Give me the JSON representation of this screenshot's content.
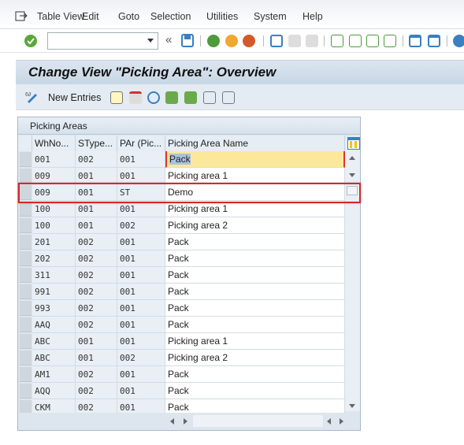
{
  "menu": {
    "items": [
      "Table View",
      "Edit",
      "Goto",
      "Selection",
      "Utilities",
      "System",
      "Help"
    ]
  },
  "toolbar": {
    "command_field_value": "",
    "icons": [
      "enter-icon",
      "back-double-icon",
      "save-icon",
      "back-icon",
      "exit-icon",
      "cancel-icon",
      "print-icon",
      "find-icon",
      "find-next-icon",
      "first-page-icon",
      "previous-page-icon",
      "next-page-icon",
      "last-page-icon",
      "new-session-icon",
      "shortcut-icon",
      "help-icon"
    ]
  },
  "title": "Change View \"Picking Area\": Overview",
  "app_toolbar": {
    "new_entries_label": "New Entries"
  },
  "table": {
    "group_title": "Picking Areas",
    "columns": [
      "WhNo...",
      "SType...",
      "PAr (Pic...",
      "Picking Area Name"
    ],
    "rows": [
      [
        "001",
        "002",
        "001",
        "Pack"
      ],
      [
        "009",
        "001",
        "001",
        "Picking area 1"
      ],
      [
        "009",
        "001",
        "ST",
        "Demo"
      ],
      [
        "100",
        "001",
        "001",
        "Picking area 1"
      ],
      [
        "100",
        "001",
        "002",
        "Picking area 2"
      ],
      [
        "201",
        "002",
        "001",
        "Pack"
      ],
      [
        "202",
        "002",
        "001",
        "Pack"
      ],
      [
        "311",
        "002",
        "001",
        "Pack"
      ],
      [
        "991",
        "002",
        "001",
        "Pack"
      ],
      [
        "993",
        "002",
        "001",
        "Pack"
      ],
      [
        "AAQ",
        "002",
        "001",
        "Pack"
      ],
      [
        "ABC",
        "001",
        "001",
        "Picking area 1"
      ],
      [
        "ABC",
        "001",
        "002",
        "Picking area 2"
      ],
      [
        "AM1",
        "002",
        "001",
        "Pack"
      ],
      [
        "AQQ",
        "002",
        "001",
        "Pack"
      ],
      [
        "CKM",
        "002",
        "001",
        "Pack"
      ]
    ],
    "focused_row": 0,
    "highlighted_row": 2
  },
  "colors": {
    "highlight_border": "#d9262b",
    "focus_cell": "#fde89a",
    "title_bar": "#c7d6e5"
  }
}
